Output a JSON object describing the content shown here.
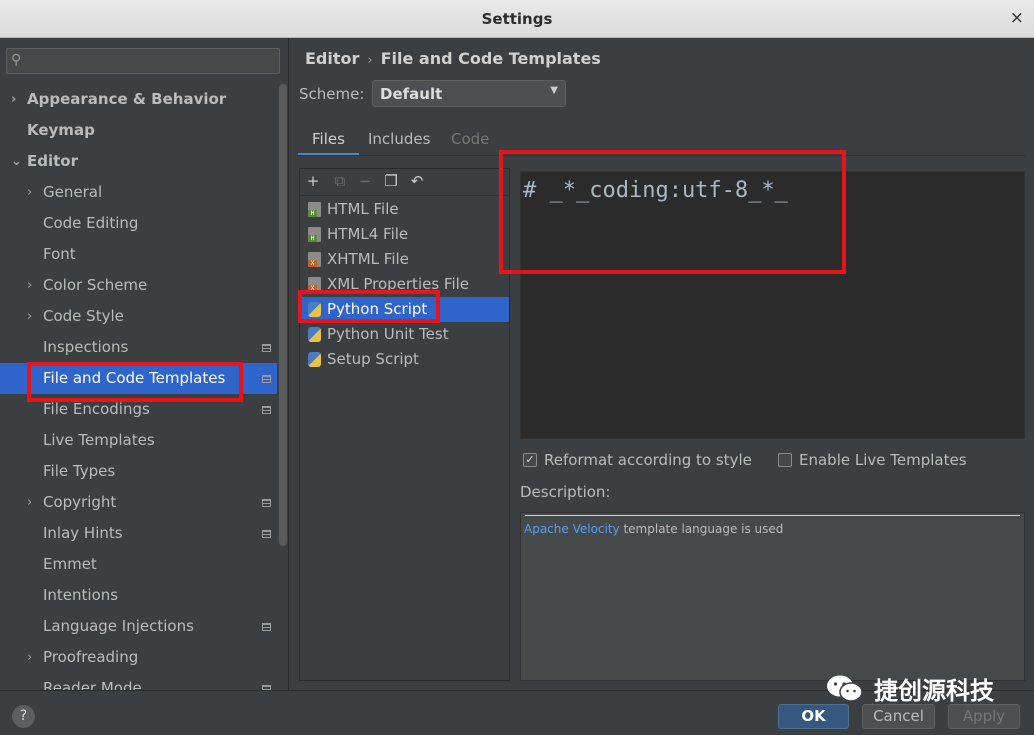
{
  "window": {
    "title": "Settings",
    "close_icon": "×"
  },
  "search": {
    "placeholder": "",
    "icon": "search-icon"
  },
  "tree": [
    {
      "label": "Appearance & Behavior",
      "level": 0,
      "bold": true,
      "arrow": "›"
    },
    {
      "label": "Keymap",
      "level": 0,
      "bold": true,
      "arrow": ""
    },
    {
      "label": "Editor",
      "level": 0,
      "bold": true,
      "arrow": "⌄"
    },
    {
      "label": "General",
      "level": 1,
      "arrow": "›"
    },
    {
      "label": "Code Editing",
      "level": 1,
      "arrow": ""
    },
    {
      "label": "Font",
      "level": 1,
      "arrow": ""
    },
    {
      "label": "Color Scheme",
      "level": 1,
      "arrow": "›"
    },
    {
      "label": "Code Style",
      "level": 1,
      "arrow": "›"
    },
    {
      "label": "Inspections",
      "level": 1,
      "arrow": "",
      "badge": true
    },
    {
      "label": "File and Code Templates",
      "level": 1,
      "arrow": "",
      "selected": true,
      "badge": true
    },
    {
      "label": "File Encodings",
      "level": 1,
      "arrow": "",
      "badge": true
    },
    {
      "label": "Live Templates",
      "level": 1,
      "arrow": ""
    },
    {
      "label": "File Types",
      "level": 1,
      "arrow": ""
    },
    {
      "label": "Copyright",
      "level": 1,
      "arrow": "›",
      "badge": true
    },
    {
      "label": "Inlay Hints",
      "level": 1,
      "arrow": "",
      "badge": true
    },
    {
      "label": "Emmet",
      "level": 1,
      "arrow": ""
    },
    {
      "label": "Intentions",
      "level": 1,
      "arrow": ""
    },
    {
      "label": "Language Injections",
      "level": 1,
      "arrow": "",
      "badge": true
    },
    {
      "label": "Proofreading",
      "level": 1,
      "arrow": "›"
    },
    {
      "label": "Reader Mode",
      "level": 1,
      "arrow": "",
      "badge": true
    }
  ],
  "breadcrumb": {
    "root": "Editor",
    "sep": "›",
    "page": "File and Code Templates"
  },
  "scheme": {
    "label": "Scheme:",
    "value": "Default"
  },
  "tabs": [
    {
      "label": "Files",
      "state": "active"
    },
    {
      "label": "Includes",
      "state": "normal"
    },
    {
      "label": "Code",
      "state": "disabled"
    }
  ],
  "toolbar": {
    "add": "+",
    "copy_inactive": "⧉",
    "remove": "−",
    "copy": "❐",
    "reset": "↶"
  },
  "templates": [
    {
      "label": "HTML File",
      "icon": "html-file-icon",
      "color": "#5e8a3c",
      "tag": "H"
    },
    {
      "label": "HTML4 File",
      "icon": "html4-file-icon",
      "color": "#5e8a3c",
      "tag": "H"
    },
    {
      "label": "XHTML File",
      "icon": "xhtml-file-icon",
      "color": "#c1642c",
      "tag": "X"
    },
    {
      "label": "XML Properties File",
      "icon": "xml-properties-file-icon",
      "color": "#c1642c",
      "tag": "X"
    },
    {
      "label": "Python Script",
      "icon": "python-file-icon",
      "color": "#4a7cc2",
      "tag": "",
      "selected": true
    },
    {
      "label": "Python Unit Test",
      "icon": "python-file-icon",
      "color": "#4a7cc2",
      "tag": ""
    },
    {
      "label": "Setup Script",
      "icon": "python-file-icon",
      "color": "#4a7cc2",
      "tag": ""
    }
  ],
  "editor": {
    "code": "# _*_coding:utf-8_*_"
  },
  "options": {
    "reformat": {
      "label": "Reformat according to style",
      "checked": true,
      "mark": "✓"
    },
    "live_templates": {
      "label": "Enable Live Templates",
      "checked": false
    }
  },
  "description": {
    "label": "Description:",
    "link": "Apache Velocity",
    "text": " template language is used"
  },
  "buttons": {
    "help": "?",
    "ok": "OK",
    "cancel": "Cancel",
    "apply": "Apply"
  },
  "watermark": {
    "text": "捷创源科技"
  },
  "colors": {
    "accent": "#2f65ca",
    "annotation": "#e8141b",
    "link": "#589df6"
  }
}
